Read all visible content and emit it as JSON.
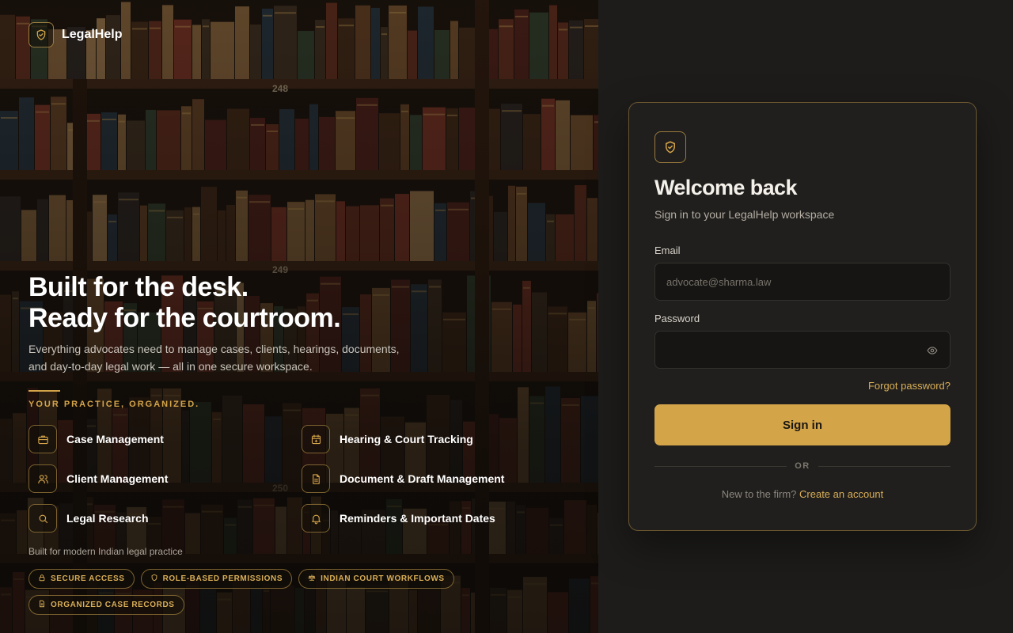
{
  "brand": {
    "name": "LegalHelp",
    "icon": "shield-icon"
  },
  "hero": {
    "headline_line1": "Built for the desk.",
    "headline_line2": "Ready for the courtroom.",
    "intro_line1": "Everything advocates need to manage cases, clients, hearings, documents,",
    "intro_line2": "and day-to-day legal work — all in one secure workspace.",
    "eyebrow": "YOUR PRACTICE, ORGANIZED.",
    "features": [
      {
        "label": "Case Management",
        "icon": "briefcase-icon"
      },
      {
        "label": "Hearing & Court Tracking",
        "icon": "calendar-icon"
      },
      {
        "label": "Client Management",
        "icon": "users-icon"
      },
      {
        "label": "Document & Draft Management",
        "icon": "document-icon"
      },
      {
        "label": "Legal Research",
        "icon": "search-icon"
      },
      {
        "label": "Reminders & Important Dates",
        "icon": "bell-icon"
      }
    ],
    "practice_note": "Built for modern Indian legal practice",
    "badges": [
      {
        "label": "SECURE ACCESS",
        "icon": "lock-icon"
      },
      {
        "label": "ROLE-BASED PERMISSIONS",
        "icon": "shield-icon"
      },
      {
        "label": "INDIAN COURT WORKFLOWS",
        "icon": "scales-icon"
      },
      {
        "label": "ORGANIZED CASE RECORDS",
        "icon": "document-icon"
      }
    ],
    "shelf_labels": [
      "248",
      "249",
      "250"
    ]
  },
  "login": {
    "title": "Welcome back",
    "subtitle": "Sign in to your LegalHelp workspace",
    "email_label": "Email",
    "email_placeholder": "advocate@sharma.law",
    "email_value": "",
    "password_label": "Password",
    "password_value": "",
    "password_toggle_icon": "eye-icon",
    "forgot_label": "Forgot password?",
    "signin_label": "Sign in",
    "divider_label": "OR",
    "signup_prompt": "New to the firm?",
    "signup_link": "Create an account"
  },
  "colors": {
    "accent": "#d4a449",
    "accent_text": "#d9ae57",
    "panel_bg": "#1d1c1a",
    "card_border": "#6a5630"
  }
}
